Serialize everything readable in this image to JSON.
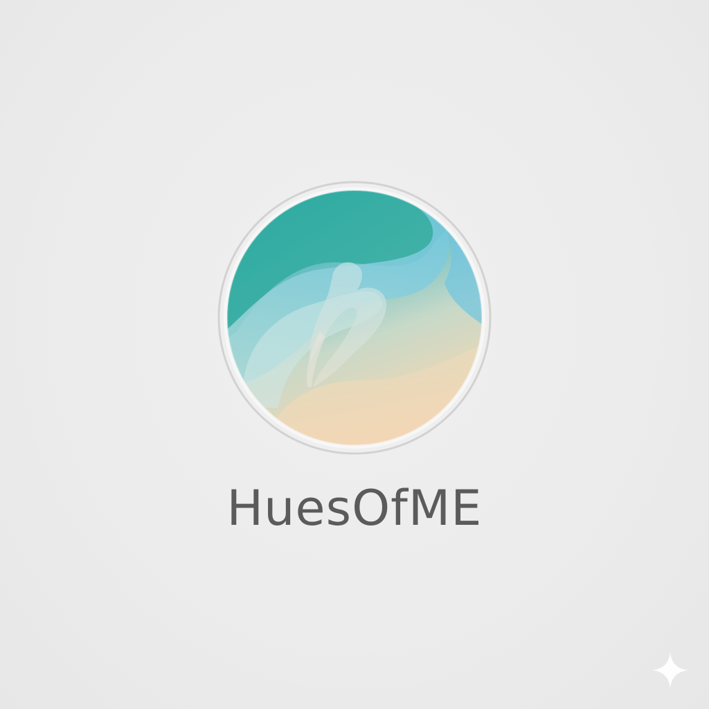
{
  "brand": {
    "name": "HuesOfME"
  },
  "logo": {
    "icon": "swirl-h-icon",
    "colors": {
      "teal": "#22a6a0",
      "sky": "#7cc9df",
      "mint": "#a9d6cf",
      "peach": "#f2d6b6",
      "ring": "#d2d2d2"
    }
  },
  "corner_mark": {
    "icon": "sparkle-icon",
    "color": "#ffffff"
  },
  "background": {
    "color": "#ececec"
  }
}
